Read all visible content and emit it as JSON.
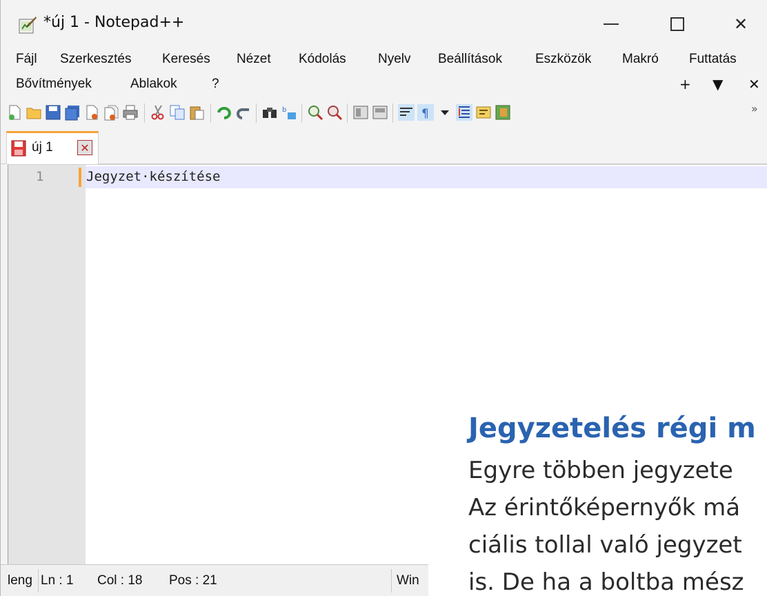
{
  "window": {
    "title": "*új 1 - Notepad++",
    "minimize_symbol": "—",
    "close_symbol": "✕"
  },
  "menu": {
    "row1": [
      "Fájl",
      "Szerkesztés",
      "Keresés",
      "Nézet",
      "Kódolás",
      "Nyelv",
      "Beállítások",
      "Eszközök",
      "Makró",
      "Futtatás"
    ],
    "row2": [
      "Bővítmények",
      "Ablakok",
      "?"
    ],
    "plus_symbol": "+",
    "dropdown_symbol": "▼",
    "close_symbol": "✕"
  },
  "toolbar": {
    "more_symbol": "»",
    "icons": [
      "new-file-icon",
      "open-file-icon",
      "save-icon",
      "save-all-icon",
      "close-icon",
      "close-all-icon",
      "print-icon",
      "cut-icon",
      "copy-icon",
      "paste-icon",
      "undo-icon",
      "redo-icon",
      "find-icon",
      "replace-icon",
      "zoom-in-icon",
      "zoom-out-icon",
      "sync-vertical-icon",
      "sync-horizontal-icon",
      "word-wrap-icon",
      "show-all-characters-icon",
      "indent-guide-icon",
      "document-map-icon",
      "function-list-icon",
      "folder-as-workspace-icon"
    ]
  },
  "tab": {
    "label": "új 1",
    "close_symbol": "✕"
  },
  "editor": {
    "line_number": "1",
    "line_text": "Jegyzet·készítése"
  },
  "status": {
    "lang": "leng",
    "ln": "Ln : 1",
    "col": "Col : 18",
    "pos": "Pos : 21",
    "eol": "Win"
  },
  "overlay": {
    "heading": "Jegyzetelés régi m",
    "lines": [
      "Egyre többen jegyzete",
      "Az érintőképernyők má",
      "ciális tollal való jegyzet",
      "is. De ha a boltba mész"
    ]
  },
  "colors": {
    "accent_orange": "#f7a43a",
    "heading_blue": "#2a63b0",
    "current_line": "#e8e8ff"
  }
}
